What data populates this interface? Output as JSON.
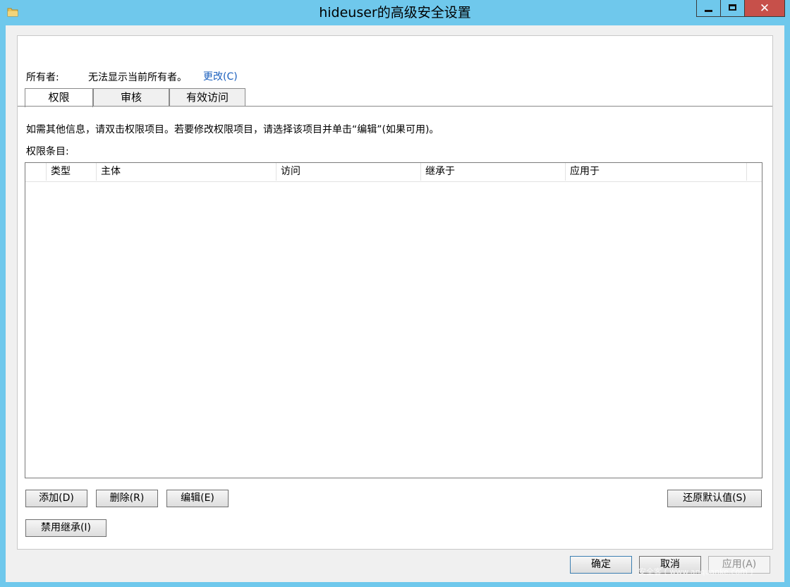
{
  "window": {
    "title": "hideuser的高级安全设置",
    "close_glyph": "✕"
  },
  "owner": {
    "label": "所有者:",
    "value": "无法显示当前所有者。",
    "change_link": "更改(C)"
  },
  "tabs": [
    {
      "label": "权限",
      "active": true
    },
    {
      "label": "审核",
      "active": false
    },
    {
      "label": "有效访问",
      "active": false
    }
  ],
  "description": "如需其他信息，请双击权限项目。若要修改权限项目，请选择该项目并单击“编辑”(如果可用)。",
  "entries_label": "权限条目:",
  "table": {
    "columns": [
      "类型",
      "主体",
      "访问",
      "继承于",
      "应用于"
    ],
    "rows": []
  },
  "buttons": {
    "add": "添加(D)",
    "remove": "删除(R)",
    "edit": "编辑(E)",
    "restore_defaults": "还原默认值(S)",
    "disable_inheritance": "禁用继承(I)",
    "ok": "确定",
    "cancel": "取消",
    "apply": "应用(A)"
  },
  "watermark": "安全客 ( www.anquanke.com )"
}
